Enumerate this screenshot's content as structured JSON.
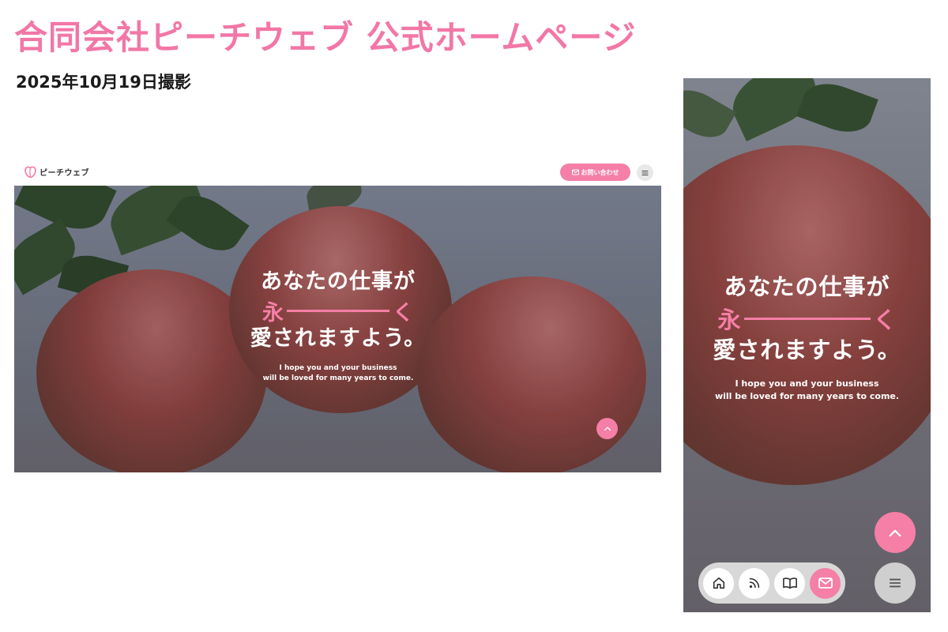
{
  "page": {
    "title": "合同会社ピーチウェブ 公式ホームページ",
    "date": "2025年10月19日撮影"
  },
  "desktop": {
    "logo_text": "ピーチウェブ",
    "contact_label": "お問い合わせ",
    "hero": {
      "line1": "あなたの仕事が",
      "line2_start": "永",
      "line2_end": "く",
      "line3": "愛されますよう。",
      "en_line1": "I hope you and your business",
      "en_line2": "will be loved for many years to come."
    },
    "icons": {
      "logo": "peach-logo-icon",
      "contact": "mail-icon",
      "menu": "menu-icon",
      "scroll_top": "chevron-up-icon"
    }
  },
  "mobile": {
    "hero": {
      "line1": "あなたの仕事が",
      "line2_start": "永",
      "line2_end": "く",
      "line3": "愛されますよう。",
      "en_line1": "I hope you and your business",
      "en_line2": "will be loved for many years to come."
    },
    "nav": [
      "home-icon",
      "rss-icon",
      "book-icon",
      "mail-icon"
    ],
    "icons": {
      "scroll_top": "chevron-up-icon",
      "menu": "menu-icon"
    }
  },
  "colors": {
    "accent": "#f57fa6",
    "title": "#f277a6",
    "text": "#1a1a1a"
  }
}
